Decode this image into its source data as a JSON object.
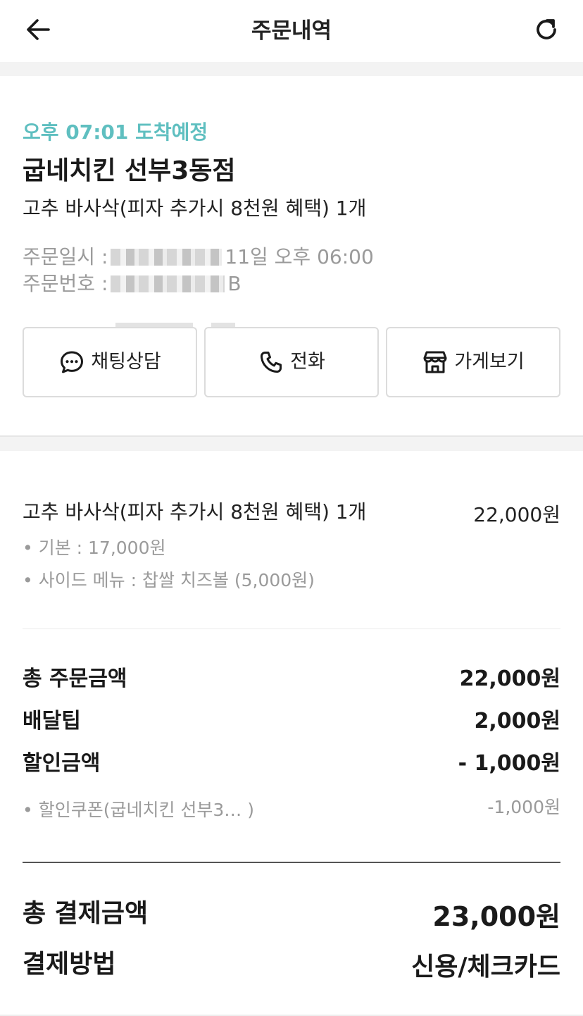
{
  "header": {
    "title": "주문내역",
    "back_icon": "arrow-left-icon",
    "refresh_icon": "refresh-icon"
  },
  "order": {
    "eta": "오후 07:01 도착예정",
    "store_name": "굽네치킨 선부3동점",
    "menu_summary": "고추 바사삭(피자 추가시 8천원 혜택) 1개",
    "date_label": "주문일시 :",
    "date_value": "11일 오후 06:00",
    "number_label": "주문번호 :",
    "number_value": "B",
    "accent_color": "#5fbfc0"
  },
  "actions": {
    "chat": {
      "label": "채팅상담",
      "icon": "chat-bubble-icon"
    },
    "call": {
      "label": "전화",
      "icon": "phone-icon"
    },
    "store": {
      "label": "가게보기",
      "icon": "store-icon"
    }
  },
  "item": {
    "name": "고추 바사삭(피자 추가시 8천원 혜택) 1개",
    "price": "22,000원",
    "options": [
      "• 기본 : 17,000원",
      "• 사이드 메뉴 : 찹쌀 치즈볼 (5,000원)"
    ]
  },
  "summary": {
    "order_total_label": "총 주문금액",
    "order_total_value": "22,000원",
    "delivery_tip_label": "배달팁",
    "delivery_tip_value": "2,000원",
    "discount_label": "할인금액",
    "discount_value": "- 1,000원",
    "coupon_label": "• 할인쿠폰(굽네치킨 선부3… )",
    "coupon_value": "-1,000원"
  },
  "payment": {
    "total_label": "총 결제금액",
    "total_value": "23,000원",
    "method_label": "결제방법",
    "method_value": "신용/체크카드"
  }
}
